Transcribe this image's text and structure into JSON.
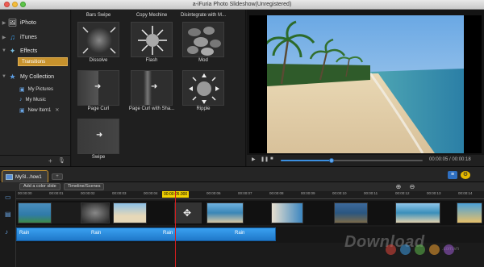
{
  "window": {
    "title": "a-iFuria Photo Slideshow(Unregistered)"
  },
  "sidebar": {
    "items": [
      {
        "label": "iPhoto",
        "icon": "iphoto-icon"
      },
      {
        "label": "iTunes",
        "icon": "itunes-icon"
      },
      {
        "label": "Effects",
        "icon": "effects-icon"
      },
      {
        "label": "My Collection",
        "icon": "star-icon"
      }
    ],
    "effects_sub": {
      "label": "Transitions"
    },
    "collection_sub": [
      {
        "label": "My Pictures"
      },
      {
        "label": "My Music"
      },
      {
        "label": "New Item1"
      }
    ],
    "footer": {
      "add": "+",
      "mic": "🎙"
    }
  },
  "transitions": [
    {
      "label": "Bars Swipe"
    },
    {
      "label": "Copy Mechine"
    },
    {
      "label": "Disintegrate with M..."
    },
    {
      "label": "Dissolve"
    },
    {
      "label": "Flash"
    },
    {
      "label": "Mod"
    },
    {
      "label": "Page Curl"
    },
    {
      "label": "Page Curl with Sha..."
    },
    {
      "label": "Ripple"
    },
    {
      "label": "Swipe"
    }
  ],
  "player": {
    "time": "00:00:05 / 00:00:18",
    "progress": 0.36
  },
  "tabs": {
    "project": "MySl...how1",
    "add": "+"
  },
  "toolbar": {
    "add_color_slide": "Add a color slide",
    "timeline_scenes": "Timeline/Scenes"
  },
  "ruler": {
    "ticks": [
      "00:00:01",
      "00:00:02",
      "00:00:03",
      "00:00:04",
      "00:00:05.000",
      "00:00:06",
      "00:00:07",
      "00:00:08",
      "00:00:09",
      "00:00:10",
      "00:00:11",
      "00:00:12",
      "00:00:13",
      "00:00:14"
    ],
    "start": "00:00:00",
    "current": "00:00:05.000"
  },
  "audio": {
    "labels": [
      "Rain",
      "Rain",
      "Rain",
      "Rain"
    ]
  },
  "watermark": {
    "brand": "Download",
    "domain": ".com.vn"
  },
  "colors": {
    "accent": "#c7922d",
    "audio": "#2b8ee0",
    "playhead": "#d31e1e"
  }
}
